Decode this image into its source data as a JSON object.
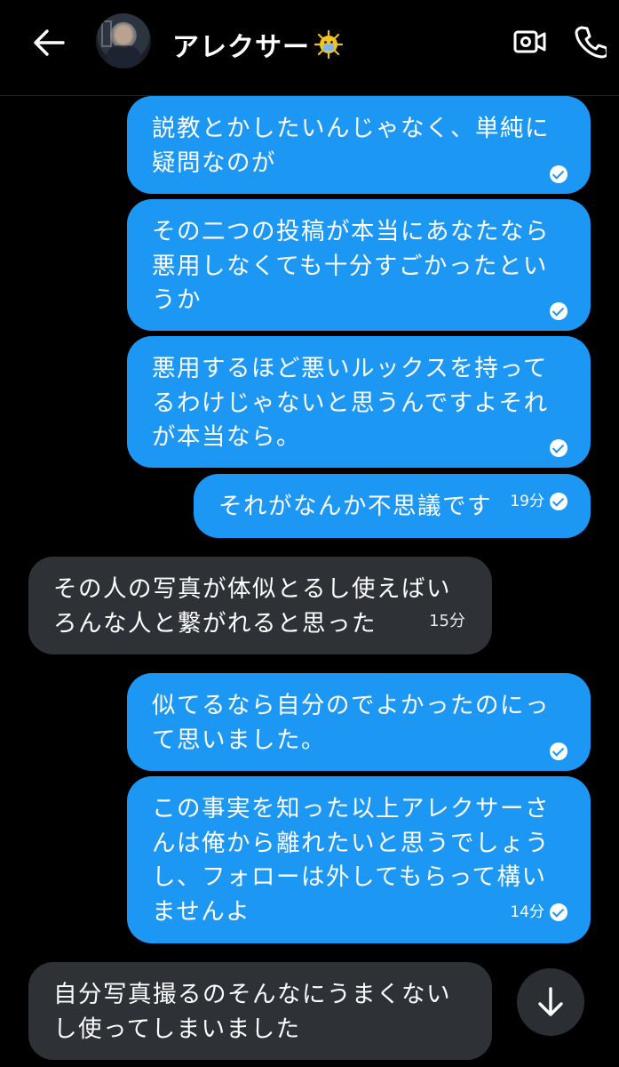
{
  "header": {
    "contact_name": "アレクサー",
    "avatar": "contact-avatar",
    "icons": {
      "back": "back-arrow-icon",
      "video": "video-call-icon",
      "phone": "phone-call-icon",
      "emoji": "virus-emoji-icon"
    }
  },
  "messages": [
    {
      "dir": "out",
      "lines": [
        "説教とかしたいんじゃなく、単純に",
        "疑問なのが"
      ],
      "time": "",
      "status": "seen"
    },
    {
      "dir": "out",
      "lines": [
        "その二つの投稿が本当にあなたなら",
        "悪用しなくても十分すごかったとい",
        "うか"
      ],
      "time": "",
      "status": "seen"
    },
    {
      "dir": "out",
      "lines": [
        "悪用するほど悪いルックスを持って",
        "るわけじゃないと思うんですよそれ",
        "が本当なら。"
      ],
      "time": "",
      "status": "seen"
    },
    {
      "dir": "out",
      "lines": [
        "それがなんか不思議です"
      ],
      "time": "19分",
      "status": "seen"
    },
    {
      "dir": "in",
      "lines": [
        "その人の写真が体似とるし使えばい",
        "ろんな人と繋がれると思った"
      ],
      "time": "15分"
    },
    {
      "dir": "out",
      "lines": [
        "似てるなら自分のでよかったのにっ",
        "て思いました。"
      ],
      "time": "",
      "status": "seen"
    },
    {
      "dir": "out",
      "lines": [
        "この事実を知った以上アレクサーさ",
        "んは俺から離れたいと思うでしょう",
        "し、フォローは外してもらって構い",
        "ませんよ"
      ],
      "time": "14分",
      "status": "seen"
    },
    {
      "dir": "in",
      "lines": [
        "自分写真撮るのそんなにうまくない",
        "し使ってしまいました"
      ],
      "time": ""
    }
  ],
  "scroll_button_icon": "arrow-down-icon",
  "colors": {
    "outgoing": "#1d97f4",
    "incoming": "#2e3236",
    "background": "#000000"
  }
}
